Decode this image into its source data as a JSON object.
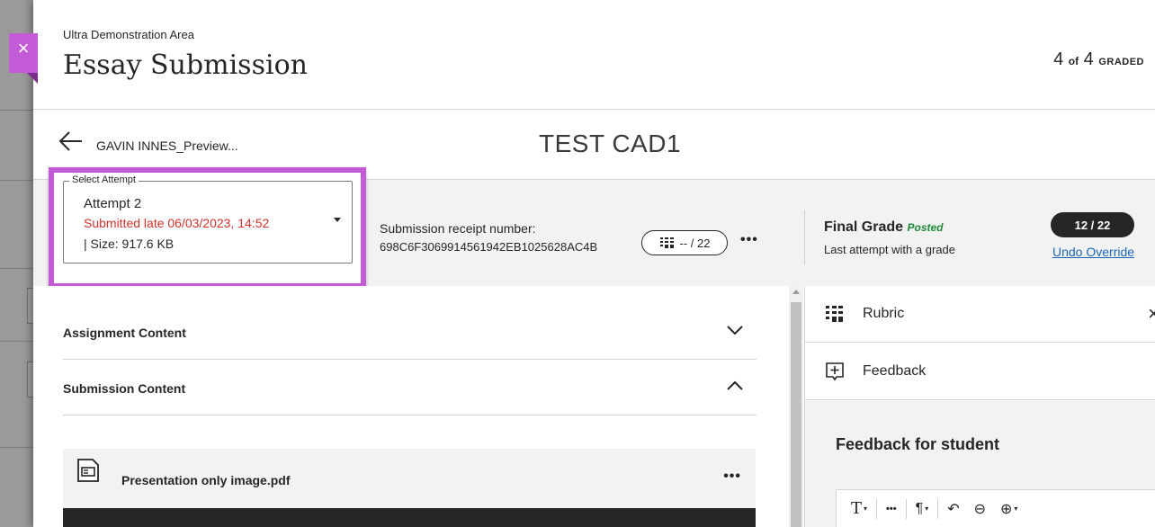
{
  "header": {
    "course_name": "Ultra Demonstration Area",
    "page_title": "Essay Submission",
    "graded_count": "4",
    "graded_of": "of",
    "graded_total": "4",
    "graded_label": "GRADED"
  },
  "close_icon": "×",
  "student": {
    "name": "GAVIN INNES_Preview...",
    "assignment_title": "TEST CAD1"
  },
  "attempt": {
    "legend": "Select Attempt",
    "name": "Attempt 2",
    "status": "Submitted late 06/03/2023, 14:52",
    "size": "| Size: 917.6 KB"
  },
  "receipt": {
    "label": "Submission receipt number:",
    "number": "698C6F3069914561942EB1025628AC4B"
  },
  "grade_pill": "-- / 22",
  "more_dots": "•••",
  "final_grade": {
    "label": "Final Grade",
    "posted": "Posted",
    "subtitle": "Last attempt with a grade",
    "score": "12  / 22",
    "undo_link": "Undo Override"
  },
  "content": {
    "assignment_section": "Assignment Content",
    "submission_section": "Submission Content",
    "file_name": "Presentation only image.pdf",
    "file_dots": "•••"
  },
  "right_panel": {
    "rubric_label": "Rubric",
    "rubric_close": "×",
    "feedback_label": "Feedback",
    "feedback_title": "Feedback for student"
  },
  "editor_toolbar": {
    "text_btn": "T",
    "more_btn": "•••",
    "para_btn": "¶",
    "undo_btn": "↶",
    "link_btn": "⊖",
    "add_btn": "⊕",
    "caret": "▾"
  },
  "colors": {
    "accent": "#c25bd5",
    "late": "#d0342c",
    "posted": "#1f8a3a",
    "link": "#1d66b8",
    "dark_badge": "#262626"
  }
}
